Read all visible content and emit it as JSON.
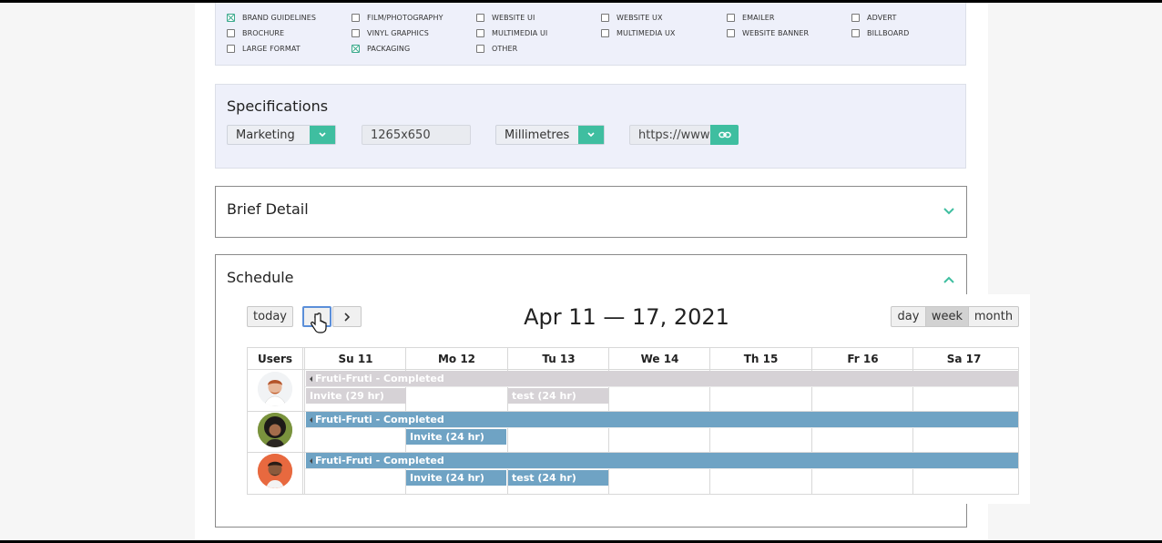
{
  "design_types": {
    "row_clipped": [
      "",
      "",
      "",
      "",
      "",
      ""
    ],
    "columns": [
      [
        "BRAND GUIDELINES",
        "BROCHURE",
        "LARGE FORMAT"
      ],
      [
        "FILM/PHOTOGRAPHY",
        "VINYL GRAPHICS",
        "PACKAGING"
      ],
      [
        "WEBSITE UI",
        "MULTIMEDIA UI",
        "OTHER"
      ],
      [
        "WEBSITE UX",
        "MULTIMEDIA UX"
      ],
      [
        "EMAILER",
        "WEBSITE BANNER"
      ],
      [
        "ADVERT",
        "BILLBOARD"
      ]
    ],
    "checked": [
      "BRAND GUIDELINES",
      "PACKAGING"
    ]
  },
  "specifications": {
    "title": "Specifications",
    "category_value": "Marketing",
    "dimensions_value": "1265x650",
    "units_value": "Millimetres",
    "url_value": "https://www"
  },
  "brief_detail": {
    "title": "Brief Detail"
  },
  "schedule": {
    "title": "Schedule",
    "today_label": "today",
    "prev_icon": "chevron-left-icon",
    "next_icon": "chevron-right-icon",
    "range_title": "Apr 11 — 17, 2021",
    "views": [
      "day",
      "week",
      "month"
    ],
    "active_view": "week",
    "users_header": "Users",
    "days": [
      "Su 11",
      "Mo 12",
      "Tu 13",
      "We 14",
      "Th 15",
      "Fr 16",
      "Sa 17"
    ],
    "rows": [
      {
        "project": "Fruti-Fruti - Completed",
        "color": "#d6d2d6",
        "tasks": [
          {
            "label": "Invite (29 hr)",
            "day": 0
          },
          {
            "label": "test (24 hr)",
            "day": 2
          }
        ]
      },
      {
        "project": "Fruti-Fruti - Completed",
        "color": "#6fa3c4",
        "tasks": [
          {
            "label": "Invite (24 hr)",
            "day": 1
          }
        ]
      },
      {
        "project": "Fruti-Fruti - Completed",
        "color": "#6fa3c4",
        "tasks": [
          {
            "label": "Invite (24 hr)",
            "day": 1
          },
          {
            "label": "test (24 hr)",
            "day": 2
          }
        ]
      }
    ]
  },
  "colors": {
    "accent": "#3fbea0",
    "panel_bg": "#eef0fa",
    "event_blue": "#6fa3c4",
    "event_gray": "#d6d2d6"
  }
}
